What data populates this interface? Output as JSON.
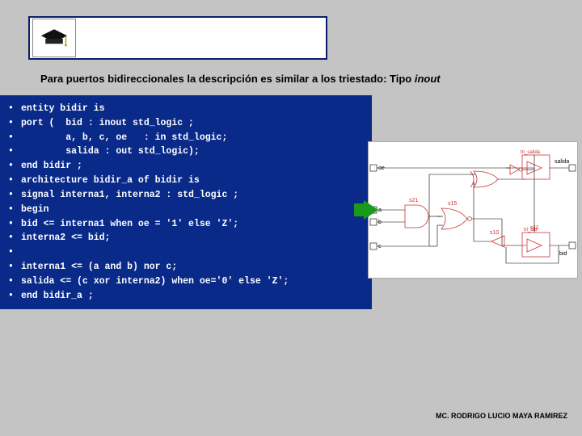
{
  "subtitle": {
    "prefix": "Para puertos bidireccionales la descripción es similar a los triestado: Tipo ",
    "keyword": "inout"
  },
  "code_lines": [
    "entity bidir is",
    "port (  bid : inout std_logic ;",
    "        a, b, c, oe   : in std_logic;",
    "        salida : out std_logic);",
    "end bidir ;",
    "architecture bidir_a of bidir is",
    "signal interna1, interna2 : std_logic ;",
    "begin",
    "bid <= interna1 when oe = '1' else 'Z';",
    "interna2 <= bid;",
    "",
    "interna1 <= (a and b) nor c;",
    "salida <= (c xor interna2) when oe='0' else 'Z';",
    "end bidir_a ;"
  ],
  "diagram": {
    "ports_left": [
      "oe",
      "a",
      "b",
      "c"
    ],
    "signals": [
      "s11",
      "s10",
      "s15",
      "s21"
    ],
    "outputs_right": [
      "salida",
      "bid"
    ],
    "buffers": [
      "tri_salida",
      "tri_bid"
    ]
  },
  "footer": "MC. RODRIGO LUCIO MAYA RAMIREZ"
}
